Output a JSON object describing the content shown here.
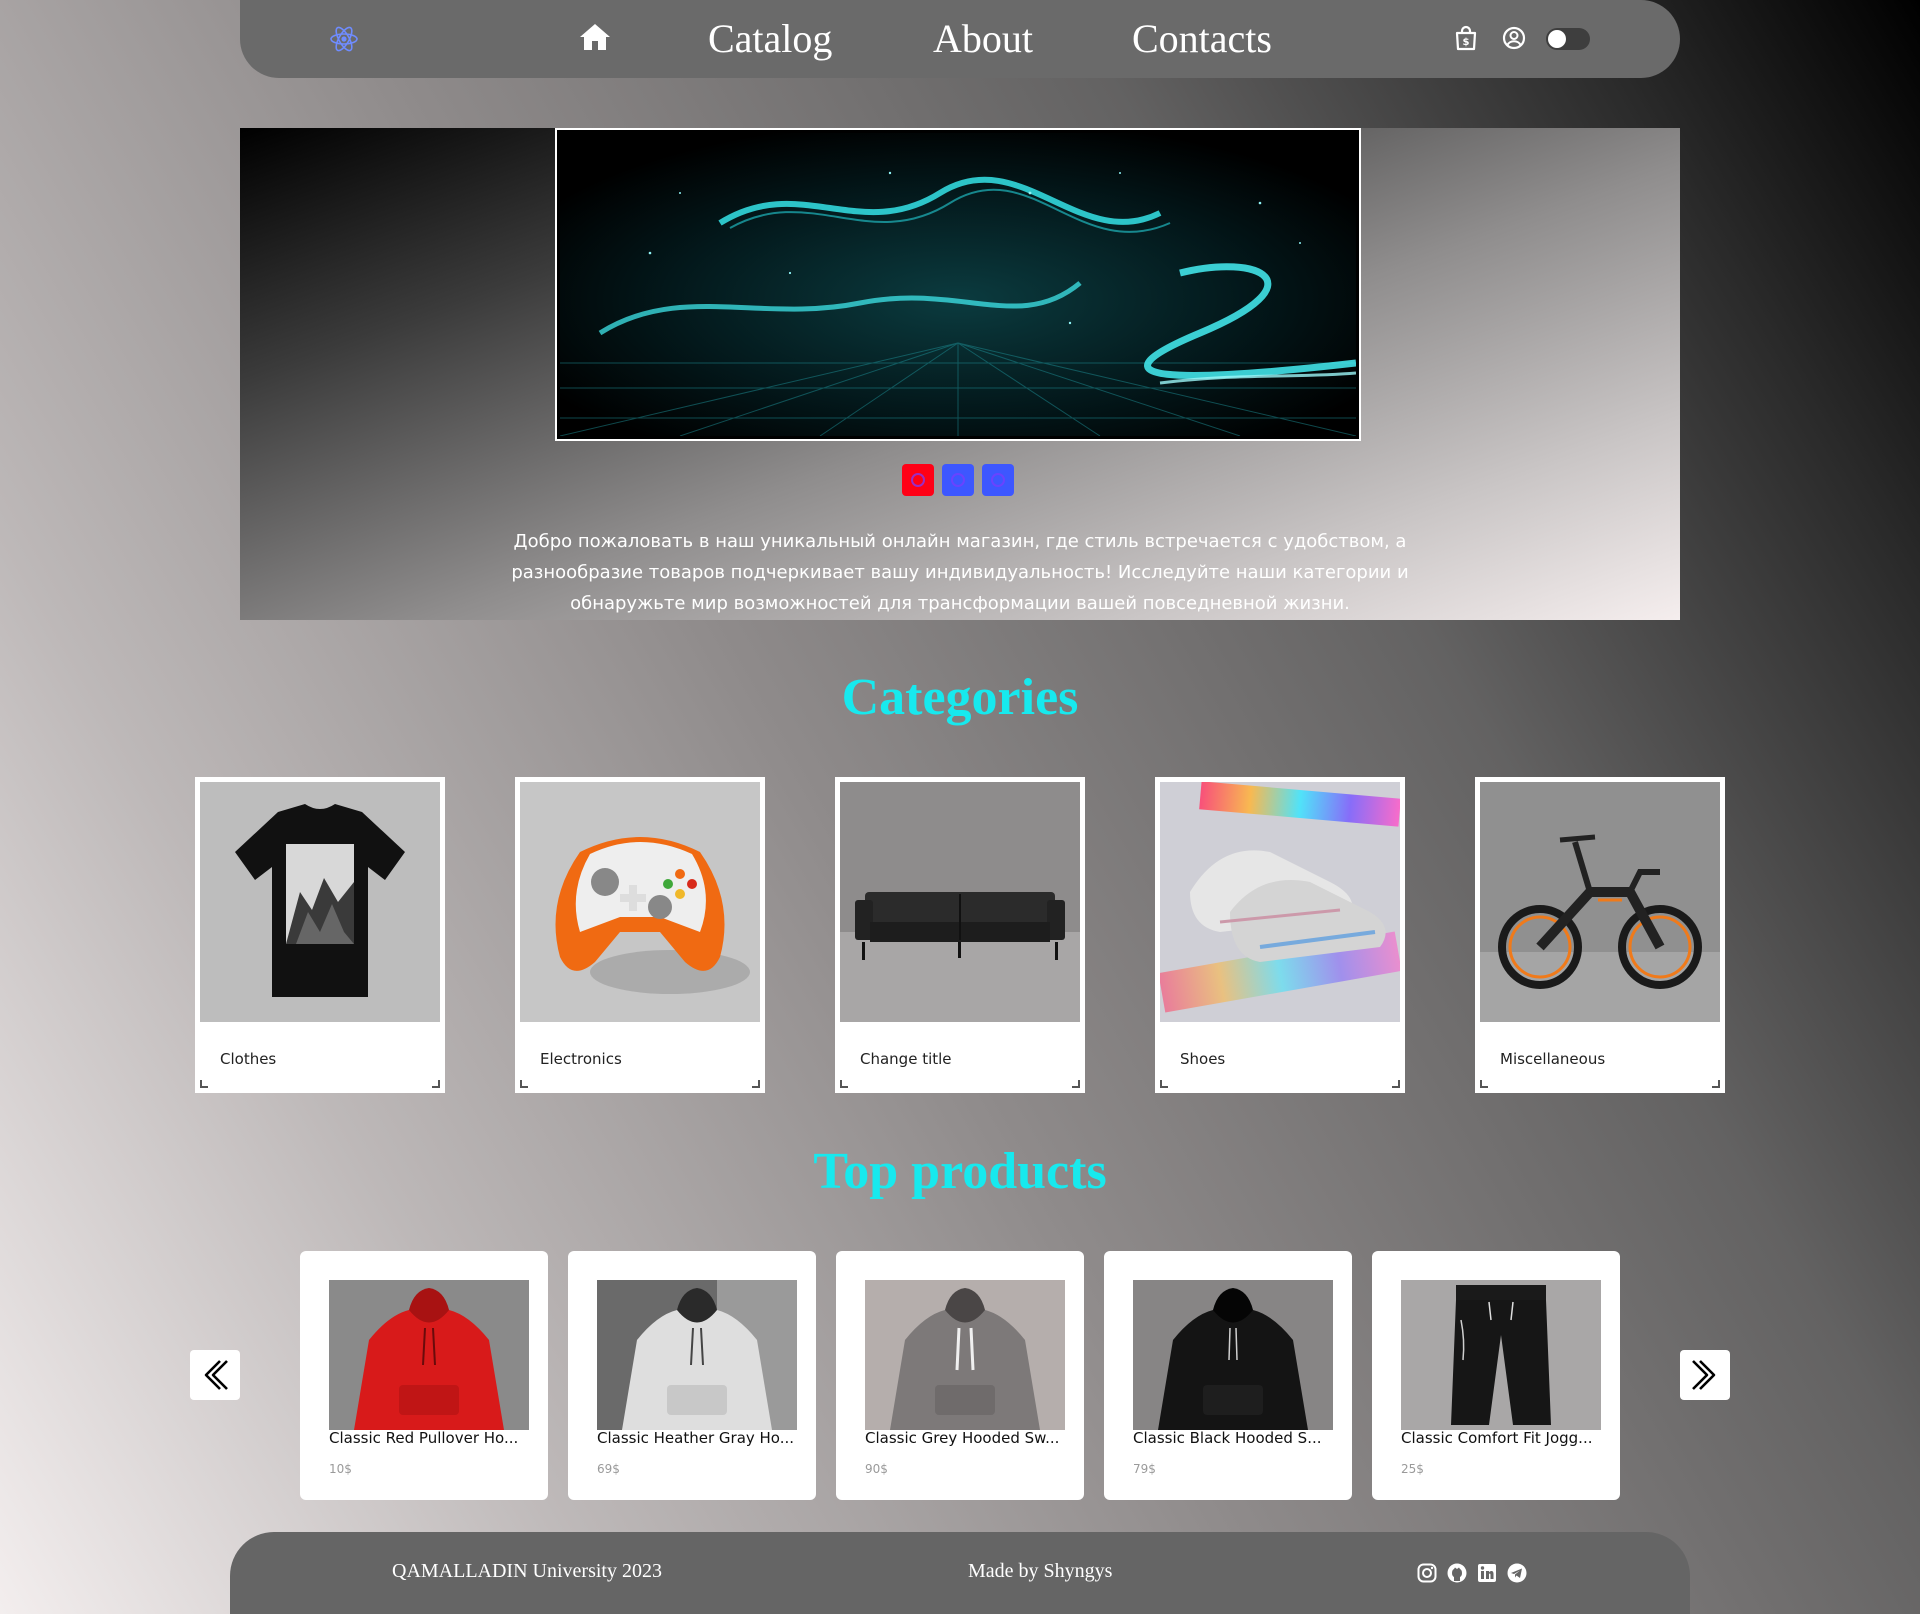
{
  "header": {
    "logo_icon": "react-atom-icon",
    "home_icon": "home-icon",
    "nav": [
      {
        "label": "Catalog"
      },
      {
        "label": "About"
      },
      {
        "label": "Contacts"
      }
    ],
    "cart_icon": "shopping-bag-icon",
    "user_icon": "user-circle-icon",
    "theme_toggle_on": false
  },
  "hero": {
    "slide_count": 3,
    "active_slide": 1,
    "text": "Добро пожаловать в наш уникальный онлайн магазин, где стиль встречается с удобством, а разнообразие товаров подчеркивает вашу индивидуальность! Исследуйте наши категории и обнаружьте мир возможностей для трансформации вашей повседневной жизни."
  },
  "categories": {
    "title": "Categories",
    "items": [
      {
        "label": "Clothes"
      },
      {
        "label": "Electronics"
      },
      {
        "label": "Change title"
      },
      {
        "label": "Shoes"
      },
      {
        "label": "Miscellaneous"
      }
    ]
  },
  "top_products": {
    "title": "Top products",
    "items": [
      {
        "name": "Classic Red Pullover Ho...",
        "price": "10$"
      },
      {
        "name": "Classic Heather Gray Ho...",
        "price": "69$"
      },
      {
        "name": "Classic Grey Hooded Sw...",
        "price": "90$"
      },
      {
        "name": "Classic Black Hooded S...",
        "price": "79$"
      },
      {
        "name": "Classic Comfort Fit Jogg...",
        "price": "25$"
      }
    ]
  },
  "footer": {
    "copyright": "QAMALLADIN University 2023",
    "made_by": "Made by Shyngys",
    "social_icons": [
      "instagram-icon",
      "github-icon",
      "linkedin-icon",
      "telegram-icon"
    ]
  },
  "colors": {
    "accent_title": "#17e9ee",
    "nav_bg": "#6a6a6a",
    "dot_active": "#ff0016",
    "dot_inactive": "#3d57ff"
  }
}
